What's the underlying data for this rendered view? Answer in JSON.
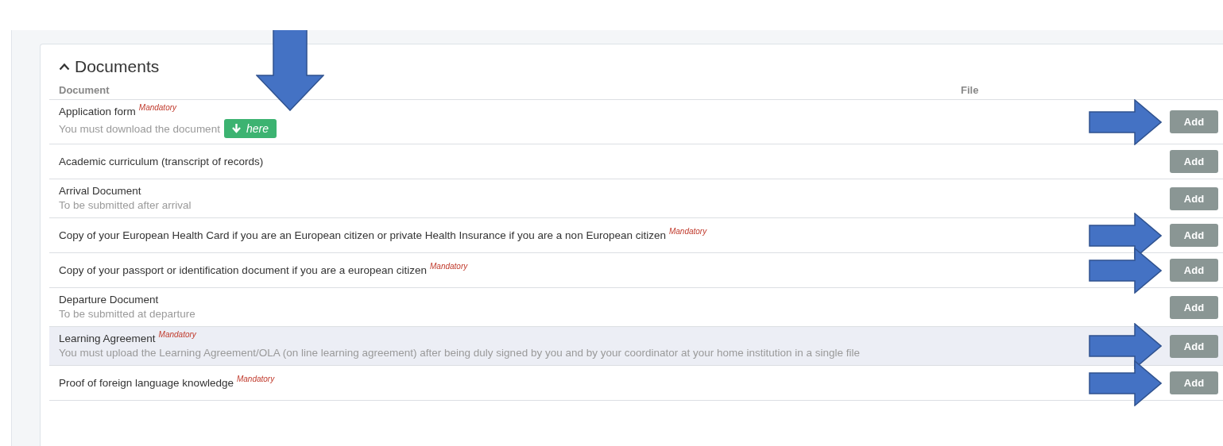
{
  "section": {
    "title": "Documents",
    "expanded": true,
    "columns": [
      "Document",
      "File"
    ],
    "down_arrow": true
  },
  "documents": [
    {
      "name": "Application form",
      "tag": "Mandatory",
      "note": "You must download the document",
      "download_label": "here",
      "button": "Add",
      "hovered": false,
      "arrow": true
    },
    {
      "name": "Academic curriculum (transcript of records)",
      "button": "Add",
      "hovered": false,
      "arrow": false
    },
    {
      "name": "Arrival Document",
      "note": "To be submitted after arrival",
      "button": "Add",
      "hovered": false,
      "arrow": false
    },
    {
      "name": "Copy of your European Health Card if you are an European citizen or private Health Insurance if you are a non European citizen",
      "tag": "Mandatory",
      "button": "Add",
      "hovered": false,
      "arrow": true
    },
    {
      "name": "Copy of your passport or identification document if you are a european citizen",
      "tag": "Mandatory",
      "button": "Add",
      "hovered": false,
      "arrow": true
    },
    {
      "name": "Departure Document",
      "note": "To be submitted at departure",
      "button": "Add",
      "hovered": false,
      "arrow": false
    },
    {
      "name": "Learning Agreement",
      "tag": "Mandatory",
      "note": "You must upload the Learning Agreement/OLA (on line learning agreement) after being duly signed by you and by your coordinator at your home institution in a single file",
      "button": "Add",
      "hovered": true,
      "arrow": true
    },
    {
      "name": "Proof of foreign language knowledge",
      "tag": "Mandatory",
      "button": "Add",
      "hovered": false,
      "arrow": true
    }
  ]
}
